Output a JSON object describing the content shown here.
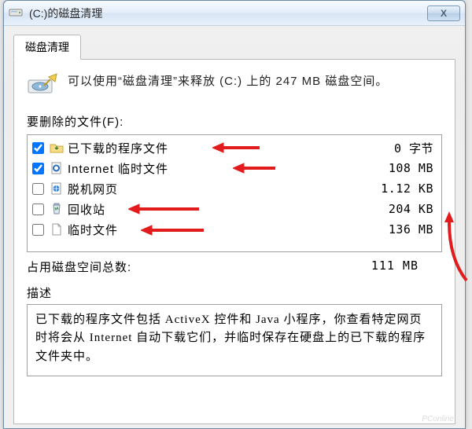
{
  "window": {
    "title": "(C:)的磁盘清理",
    "close_symbol": "X"
  },
  "tab": {
    "label": "磁盘清理"
  },
  "intro": {
    "text": "可以使用“磁盘清理”来释放  (C:) 上的 247 MB 磁盘空间。"
  },
  "files": {
    "section_label": "要删除的文件(F):",
    "items": [
      {
        "name": "已下载的程序文件",
        "size": "0 字节",
        "checked": true,
        "icon": "folder-download"
      },
      {
        "name": "Internet 临时文件",
        "size": "108 MB",
        "checked": true,
        "icon": "page-ie"
      },
      {
        "name": "脱机网页",
        "size": "1.12 KB",
        "checked": false,
        "icon": "globe-page"
      },
      {
        "name": "回收站",
        "size": "204 KB",
        "checked": false,
        "icon": "recycle-bin"
      },
      {
        "name": "临时文件",
        "size": "136 MB",
        "checked": false,
        "icon": "page-blank"
      }
    ]
  },
  "total": {
    "label": "占用磁盘空间总数:",
    "value": "111 MB"
  },
  "description": {
    "label": "描述",
    "body": "已下载的程序文件包括 ActiveX 控件和 Java 小程序，你查看特定网页时将会从 Internet 自动下载它们，并临时保存在硬盘上的已下载的程序文件夹中。"
  }
}
